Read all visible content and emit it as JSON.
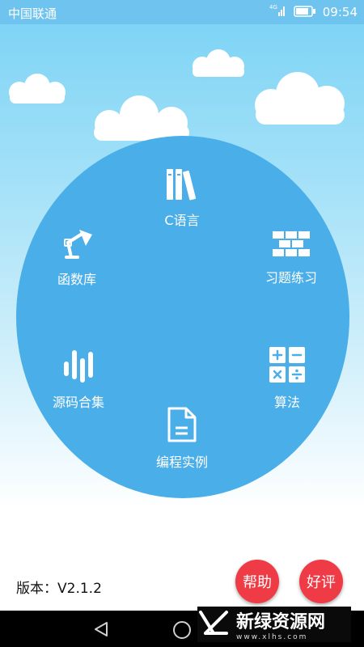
{
  "status_bar": {
    "carrier": "中国联通",
    "network": "4G",
    "time": "09:54"
  },
  "menu": {
    "items": [
      {
        "label": "C语言",
        "icon": "books-icon"
      },
      {
        "label": "习题练习",
        "icon": "bricks-icon"
      },
      {
        "label": "算法",
        "icon": "calculator-icon"
      },
      {
        "label": "编程实例",
        "icon": "document-icon"
      },
      {
        "label": "源码合集",
        "icon": "bars-icon"
      },
      {
        "label": "函数库",
        "icon": "lamp-icon"
      }
    ]
  },
  "footer": {
    "version": "版本：V2.1.2",
    "help_label": "帮助",
    "rate_label": "好评"
  },
  "watermark": {
    "text": "新绿资源网",
    "sub": "www.xlhs.com"
  },
  "colors": {
    "status_bar": "#6fc3ef",
    "wheel": "#4aaee8",
    "button": "#ef3b45"
  }
}
